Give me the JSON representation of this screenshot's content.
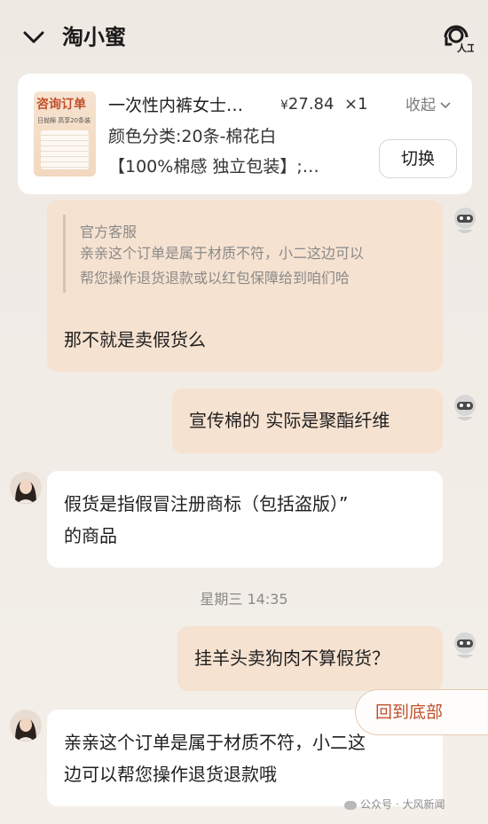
{
  "header": {
    "title": "淘小蜜",
    "agent_icon_label": "人工"
  },
  "order_card": {
    "thumb_tag": "咨询订单",
    "thumb_text": "日抛棉 高享20条装",
    "product_name": "一次性内裤女士…",
    "price_symbol": "¥",
    "price": "27.84",
    "quantity": "×1",
    "collapse_label": "收起",
    "spec": "颜色分类:20条-棉花白",
    "desc": "【100%棉感 独立包装】;…",
    "switch_label": "切换"
  },
  "messages": {
    "m1": {
      "quote_name": "官方客服",
      "quote_line1": "亲亲这个订单是属于材质不符，小二这边可以",
      "quote_line2": "帮您操作退货退款或以红包保障给到咱们哈",
      "text": "那不就是卖假货么"
    },
    "m2": {
      "text": "宣传棉的 实际是聚酯纤维"
    },
    "m3": {
      "line1": "假货是指假冒注册商标（包括盗版）”",
      "line2": "的商品"
    },
    "m4": {
      "text": "挂羊头卖狗肉不算假货？"
    },
    "m5": {
      "line1": "亲亲这个订单是属于材质不符，小二这",
      "line2": "边可以帮您操作退货退款哦"
    }
  },
  "timestamp": "星期三 14:35",
  "back_to_bottom": "回到底部",
  "watermark": "公众号 · 大风新闻",
  "colors": {
    "accent": "#c0502c",
    "user_bubble": "#f6e2d0",
    "staff_bubble": "#ffffff",
    "background": "#efe9e4"
  }
}
